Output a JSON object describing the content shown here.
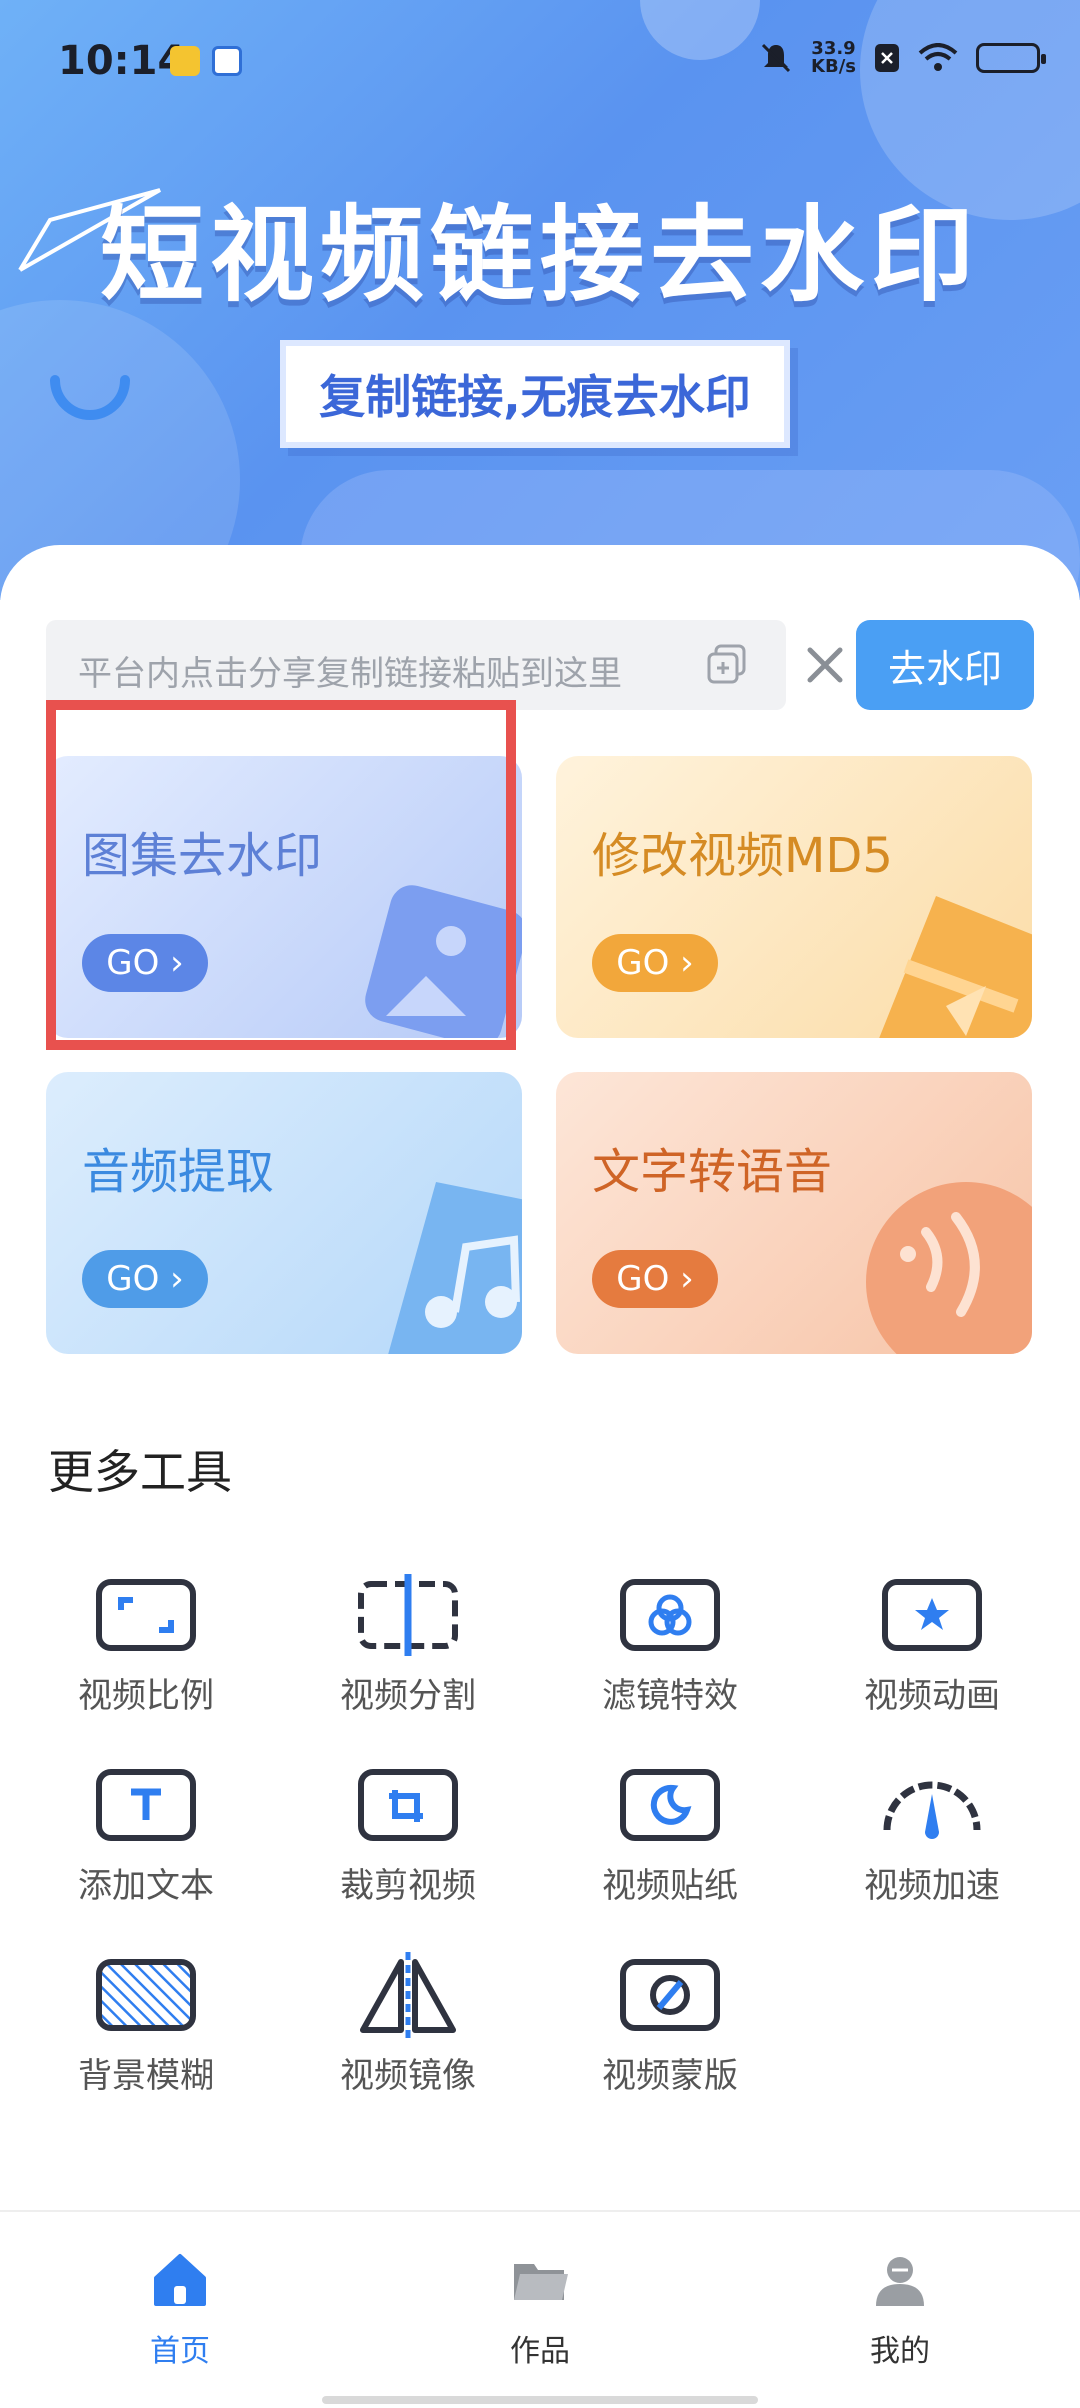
{
  "status_bar": {
    "time": "10:14",
    "net_speed_value": "33.9",
    "net_speed_unit": "KB/s"
  },
  "banner": {
    "title": "短视频链接去水印",
    "subtitle": "复制链接,无痕去水印"
  },
  "search": {
    "placeholder": "平台内点击分享复制链接粘贴到这里",
    "button_label": "去水印"
  },
  "cards": [
    {
      "title": "图集去水印",
      "go_label": "GO ›",
      "color": "#7c9ef0"
    },
    {
      "title": "修改视频MD5",
      "go_label": "GO ›",
      "color": "#f2a73b"
    },
    {
      "title": "音频提取",
      "go_label": "GO ›",
      "color": "#4f9ce8"
    },
    {
      "title": "文字转语音",
      "go_label": "GO ›",
      "color": "#e57b3f"
    }
  ],
  "more_tools": {
    "title": "更多工具",
    "items": [
      {
        "label": "视频比例",
        "icon": "aspect-ratio-icon"
      },
      {
        "label": "视频分割",
        "icon": "split-icon"
      },
      {
        "label": "滤镜特效",
        "icon": "filter-icon"
      },
      {
        "label": "视频动画",
        "icon": "animation-icon"
      },
      {
        "label": "添加文本",
        "icon": "text-icon"
      },
      {
        "label": "裁剪视频",
        "icon": "crop-icon"
      },
      {
        "label": "视频贴纸",
        "icon": "sticker-icon"
      },
      {
        "label": "视频加速",
        "icon": "speed-icon"
      },
      {
        "label": "背景模糊",
        "icon": "blur-icon"
      },
      {
        "label": "视频镜像",
        "icon": "mirror-icon"
      },
      {
        "label": "视频蒙版",
        "icon": "mask-icon"
      }
    ]
  },
  "bottom_nav": [
    {
      "label": "首页",
      "icon": "home-icon",
      "active": true
    },
    {
      "label": "作品",
      "icon": "folder-icon",
      "active": false
    },
    {
      "label": "我的",
      "icon": "profile-icon",
      "active": false
    }
  ],
  "colors": {
    "accent": "#4a9ff4",
    "active_nav": "#2f7ef0",
    "inactive_nav": "#333333",
    "highlight_border": "#e8514e"
  }
}
